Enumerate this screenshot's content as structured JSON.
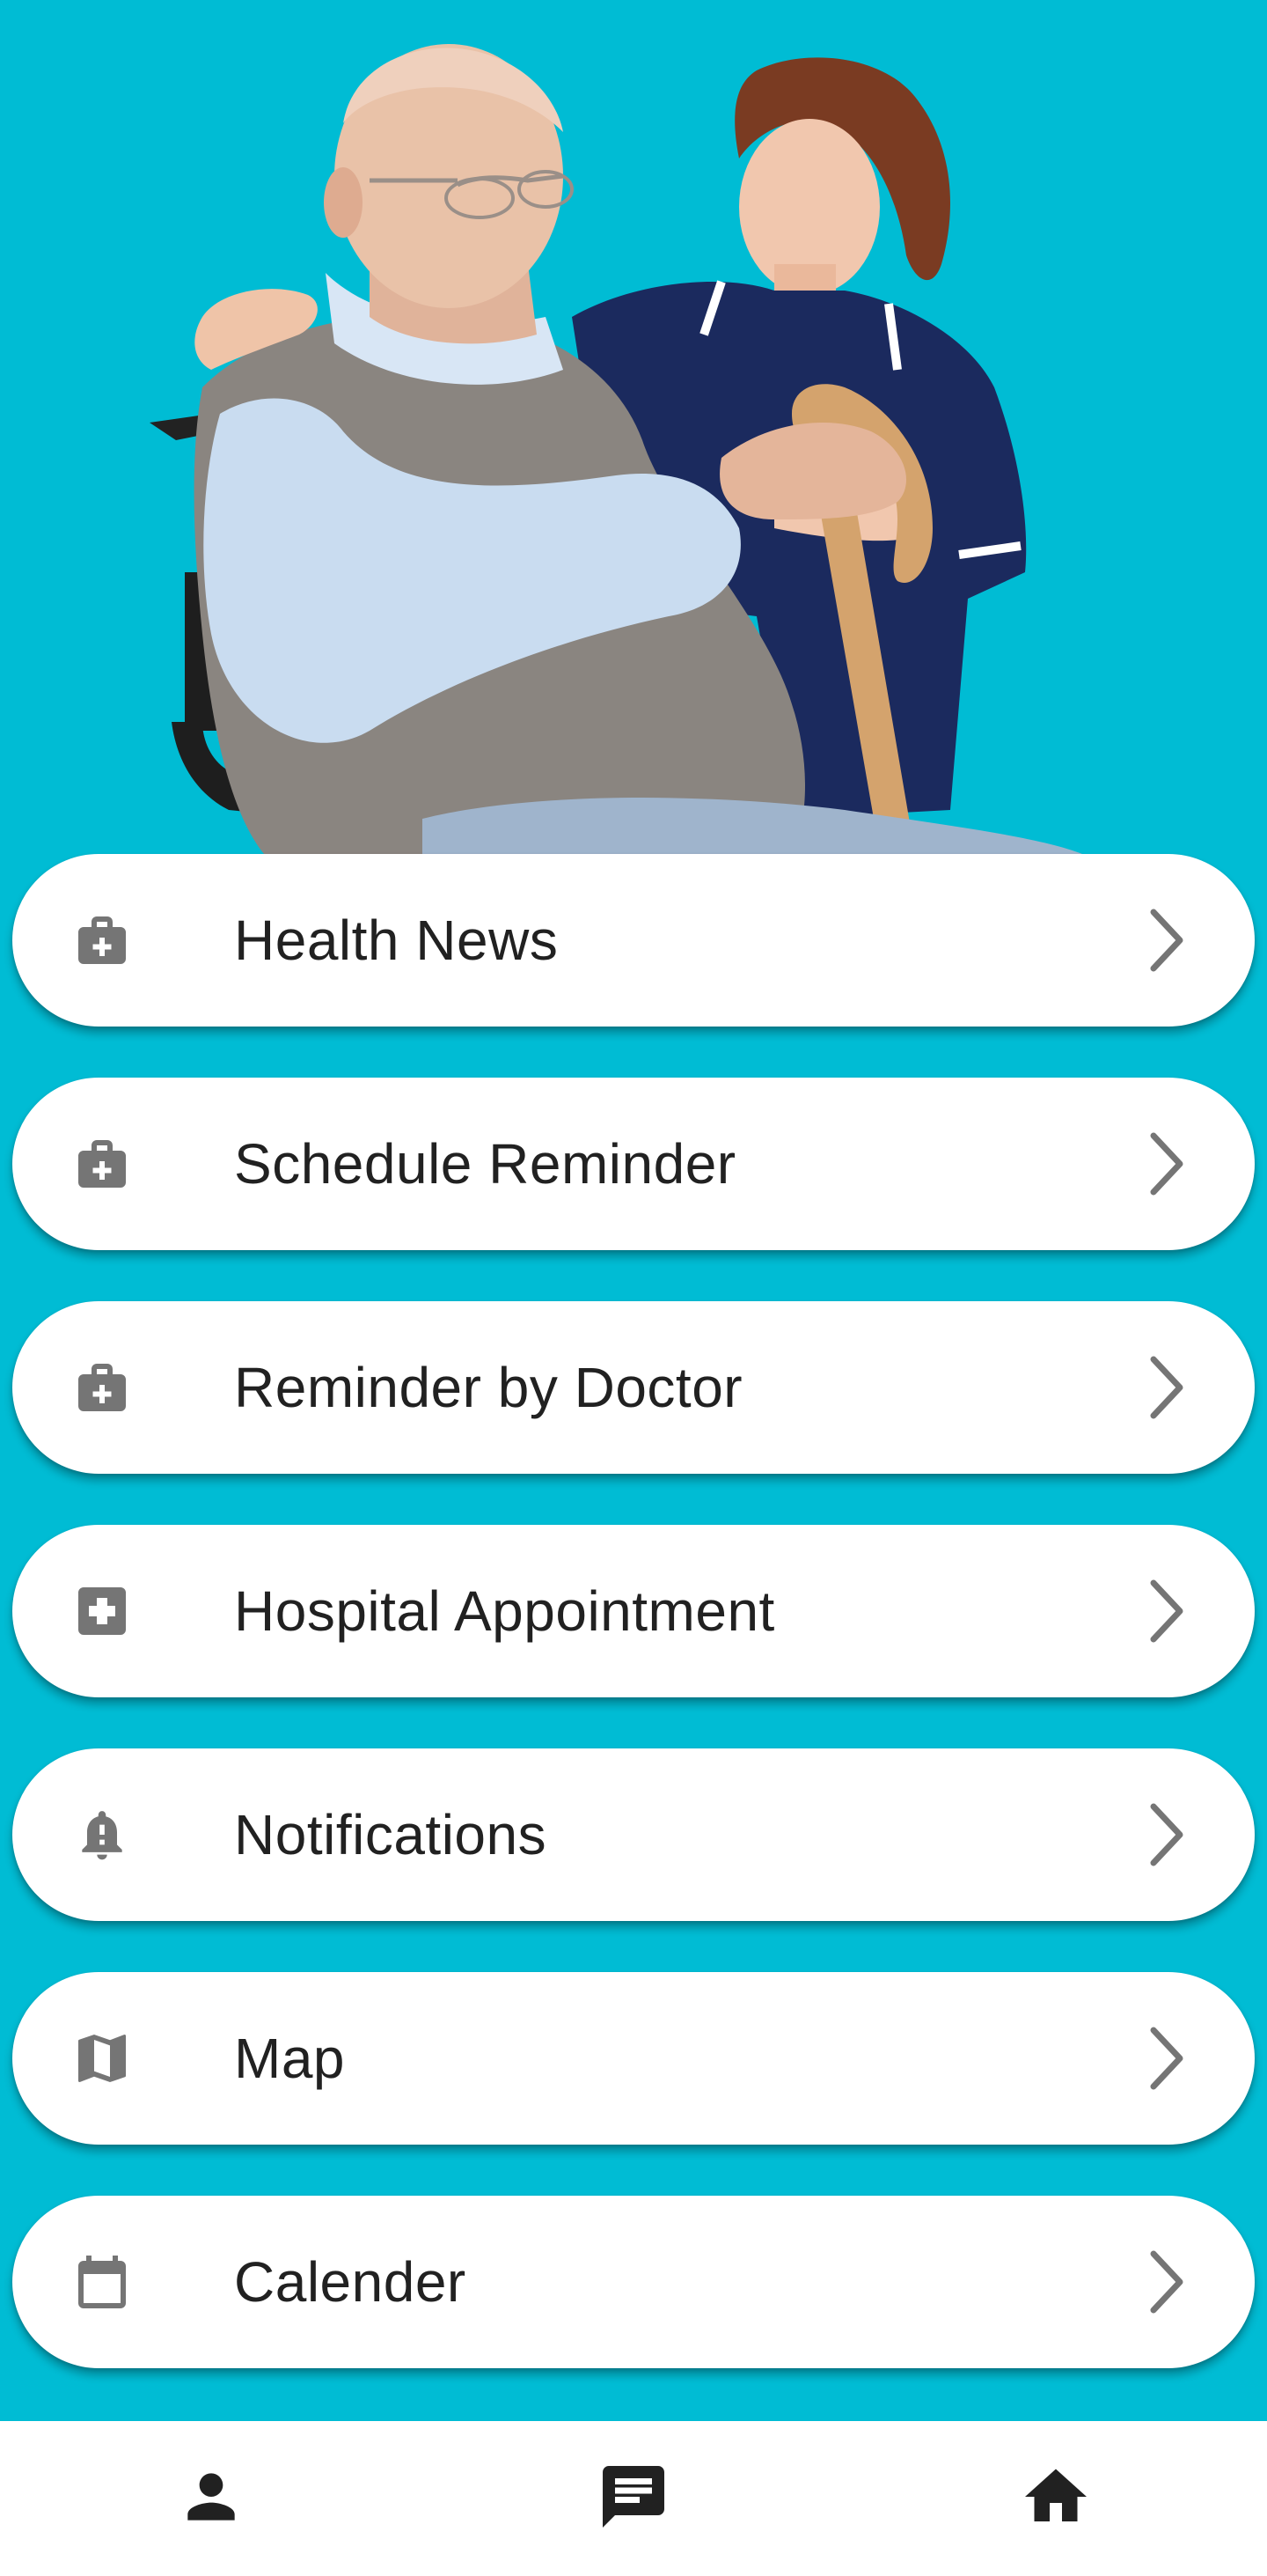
{
  "hero": {
    "image_description": "elderly-man-with-nurse"
  },
  "menu": {
    "items": [
      {
        "label": "Health News",
        "icon": "medical-bag-icon"
      },
      {
        "label": "Schedule Reminder",
        "icon": "medical-bag-icon"
      },
      {
        "label": "Reminder by Doctor",
        "icon": "medical-bag-icon"
      },
      {
        "label": "Hospital Appointment",
        "icon": "hospital-box-icon"
      },
      {
        "label": "Notifications",
        "icon": "bell-alert-icon"
      },
      {
        "label": "Map",
        "icon": "map-icon"
      },
      {
        "label": "Calender",
        "icon": "calendar-icon"
      }
    ]
  },
  "bottom_nav": {
    "items": [
      {
        "icon": "person-icon"
      },
      {
        "icon": "chat-icon"
      },
      {
        "icon": "home-icon"
      }
    ]
  },
  "colors": {
    "background": "#00BCD4",
    "card": "#FFFFFF",
    "icon_gray": "#757575",
    "text": "#212121"
  }
}
